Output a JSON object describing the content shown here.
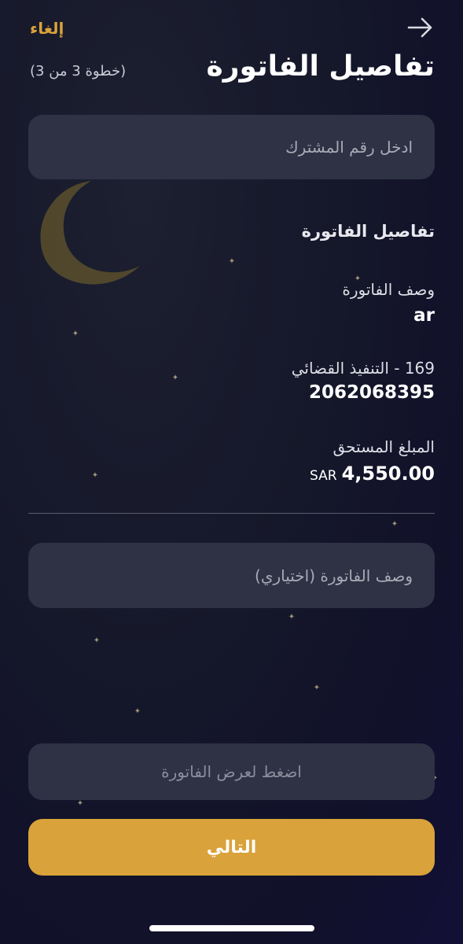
{
  "header": {
    "cancel_label": "إلغاء",
    "title": "تفاصيل الفاتورة",
    "step": "(خطوة 3 من 3)"
  },
  "subscriber_field": {
    "placeholder": "ادخل رقم المشترك"
  },
  "bill_details": {
    "section_title": "تفاصيل الفاتورة",
    "description_label": "وصف الفاتورة",
    "description_value": "ar",
    "service_label": "169 - التنفيذ القضائي",
    "service_value": "2062068395",
    "amount_label": "المبلغ المستحق",
    "amount_value": "4,550.00",
    "currency": "SAR"
  },
  "description_field": {
    "placeholder": "وصف الفاتورة (اختياري)"
  },
  "view_bill_field": {
    "placeholder": "اضغط لعرض الفاتورة"
  },
  "next_button": {
    "label": "التالي"
  },
  "colors": {
    "accent": "#d9a23a",
    "field_background": "#2e3244",
    "background": "#15172a"
  },
  "icons": {
    "back": "arrow-right-icon",
    "moon": "crescent-moon-icon",
    "star": "star-icon"
  }
}
